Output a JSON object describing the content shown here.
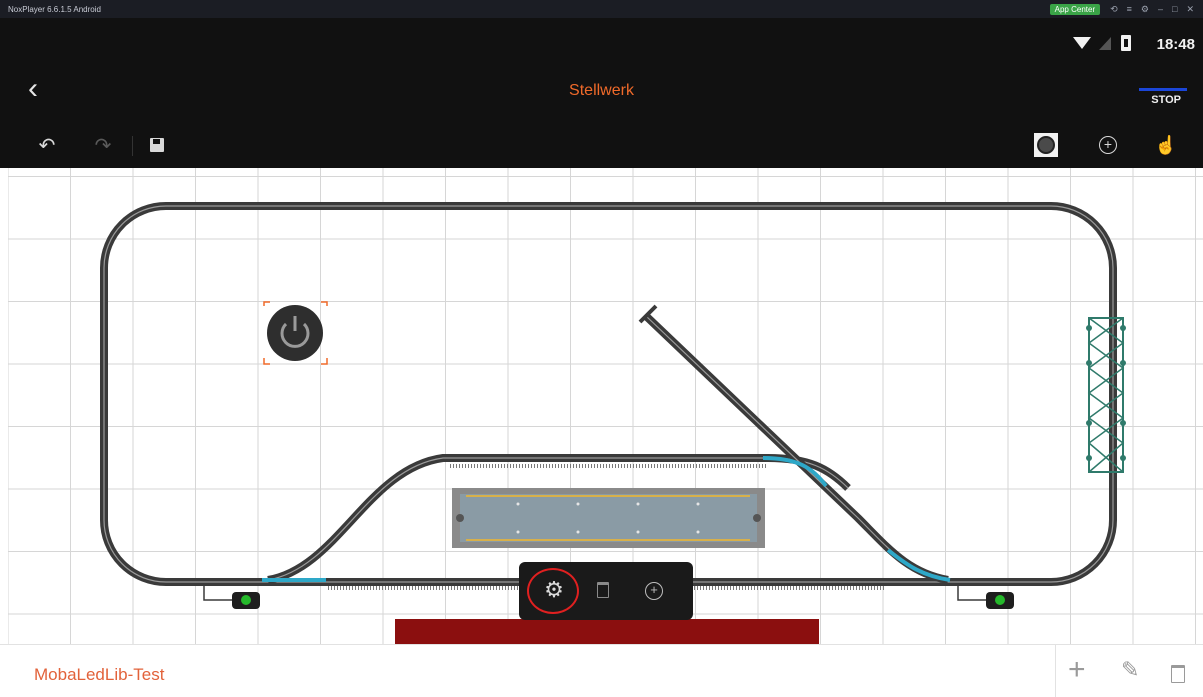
{
  "emulator": {
    "title": "NoxPlayer 6.6.1.5 Android",
    "app_center": "App Center",
    "controls": [
      "⟲",
      "≡",
      "⚙",
      "–",
      "□",
      "✕"
    ]
  },
  "status_bar": {
    "time": "18:48"
  },
  "header": {
    "back_label": "‹",
    "title": "Stellwerk",
    "stop_label": "STOP"
  },
  "toolbar": {
    "undo_icon": "undo-icon",
    "redo_icon": "redo-icon",
    "save_icon": "save-icon",
    "frame_icon": "frame-icon",
    "add_icon": "add-circle-icon",
    "hand_icon": "hand-pointer-icon"
  },
  "context_menu": {
    "settings_icon": "gear-icon",
    "delete_icon": "trash-icon",
    "add_icon": "add-circle-icon"
  },
  "layout": {
    "name": "MobaLedLib-Test"
  },
  "bottom_actions": {
    "add_label": "+",
    "edit_label": "✎"
  },
  "colors": {
    "accent": "#f06a2a",
    "track": "#3a3a3a",
    "switch_blue": "#2ea8c8",
    "platform": "#8a9ba5",
    "buffer_red": "#8b0f0f",
    "signal_green": "#25b92b",
    "bridge_teal": "#2f7a6b"
  }
}
